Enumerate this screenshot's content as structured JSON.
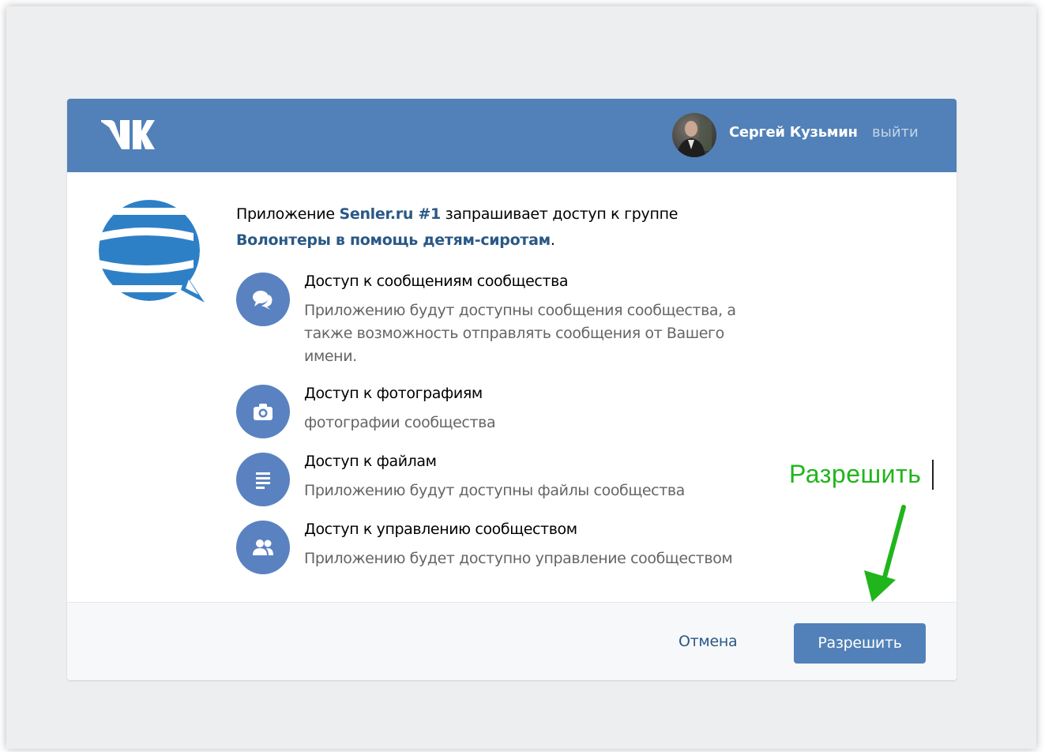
{
  "header": {
    "logo_icon": "vk-logo",
    "avatar_icon": "user-avatar",
    "user_name": "Сергей Кузьмин",
    "logout_label": "выйти"
  },
  "request": {
    "app_logo_icon": "senler-logo",
    "prefix": "Приложение ",
    "app_name": "Senler.ru #1",
    "middle": " запрашивает доступ к группе",
    "group_name": "Волонтеры в помощь детям-сиротам",
    "suffix": "."
  },
  "permissions": [
    {
      "icon": "chat-bubbles-icon",
      "title": "Доступ к сообщениям сообщества",
      "description": "Приложению будут доступны сообщения сообщества, а также возможность отправлять сообщения от Вашего имени."
    },
    {
      "icon": "camera-icon",
      "title": "Доступ к фотографиям",
      "description": "фотографии сообщества"
    },
    {
      "icon": "document-lines-icon",
      "title": "Доступ к файлам",
      "description": "Приложению будут доступны файлы сообщества"
    },
    {
      "icon": "people-icon",
      "title": "Доступ к управлению сообществом",
      "description": "Приложению будет доступно управление сообществом"
    }
  ],
  "footer": {
    "cancel_label": "Отмена",
    "allow_label": "Разрешить"
  },
  "annotation": {
    "text": "Разрешить",
    "color": "#21b51c",
    "arrow_icon": "green-arrow"
  },
  "colors": {
    "header_bg": "#5181b8",
    "link": "#2a5885",
    "perm_icon_bg": "#5a82c0",
    "page_bg": "#edeef0"
  }
}
